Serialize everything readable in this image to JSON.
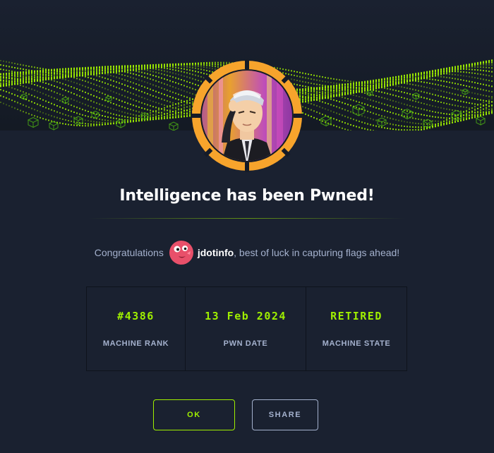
{
  "modal": {
    "title": "Intelligence has been Pwned!",
    "congrats_prefix": "Congratulations",
    "username": "jdotinfo",
    "congrats_suffix": ", best of luck in capturing flags ahead!"
  },
  "stats": [
    {
      "value": "#4386",
      "label": "MACHINE RANK"
    },
    {
      "value": "13 Feb 2024",
      "label": "PWN DATE"
    },
    {
      "value": "RETIRED",
      "label": "MACHINE STATE"
    }
  ],
  "buttons": {
    "ok_label": "OK",
    "share_label": "SHARE"
  },
  "colors": {
    "background": "#1a2130",
    "accent": "#9fef00",
    "muted": "#a4b1cd",
    "avatar_ring": "#f7a42c"
  },
  "icons": {
    "machine_avatar": "machine-avatar-icon",
    "user_avatar": "user-avatar-icon",
    "banner": "green-wave-banner"
  }
}
